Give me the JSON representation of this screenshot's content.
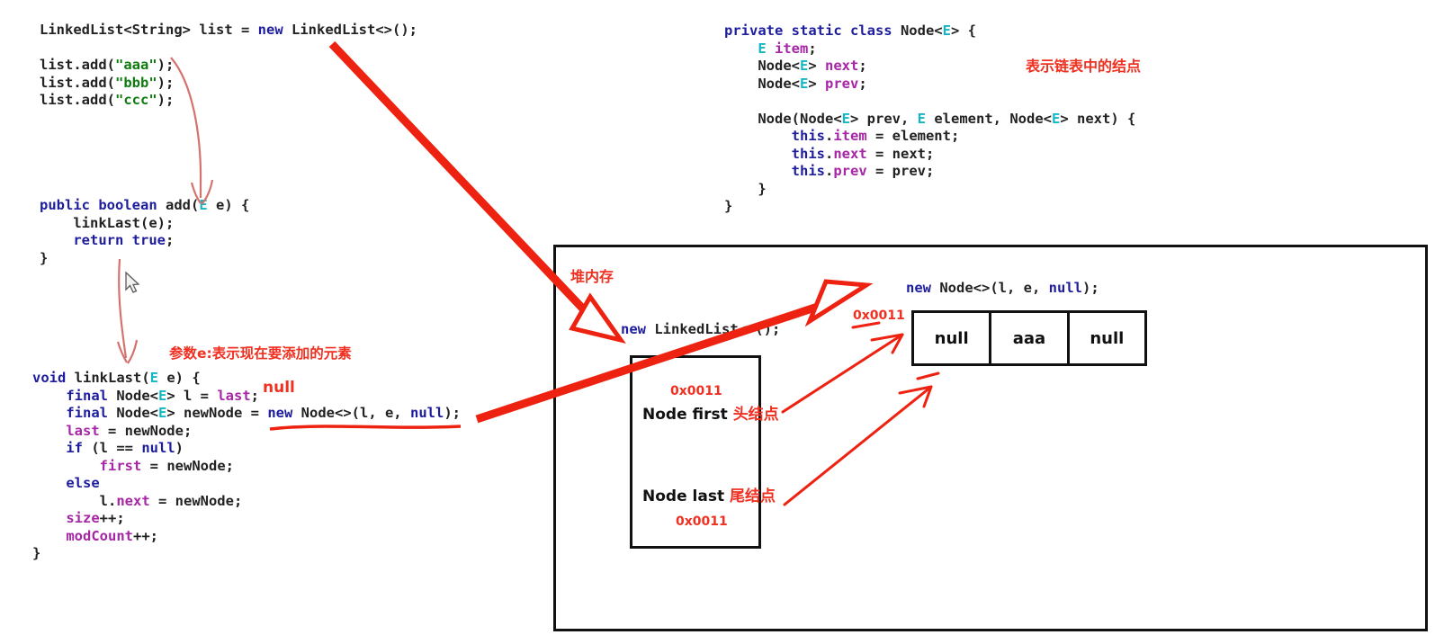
{
  "code_main": {
    "lines": [
      [
        {
          "t": "LinkedList",
          "c": "pl"
        },
        {
          "t": "<String> ",
          "c": "pl"
        },
        {
          "t": "list ",
          "c": "pl"
        },
        {
          "t": "= ",
          "c": "pl"
        },
        {
          "t": "new",
          "c": "kw"
        },
        {
          "t": " LinkedList<>();",
          "c": "pl"
        }
      ],
      [],
      [
        {
          "t": "list.add(",
          "c": "pl"
        },
        {
          "t": "\"aaa\"",
          "c": "str"
        },
        {
          "t": ");",
          "c": "pl"
        }
      ],
      [
        {
          "t": "list.add(",
          "c": "pl"
        },
        {
          "t": "\"bbb\"",
          "c": "str"
        },
        {
          "t": ");",
          "c": "pl"
        }
      ],
      [
        {
          "t": "list.add(",
          "c": "pl"
        },
        {
          "t": "\"ccc\"",
          "c": "str"
        },
        {
          "t": ");",
          "c": "pl"
        }
      ]
    ],
    "plain": "LinkedList<String> list = new LinkedList<>();\n\nlist.add(\"aaa\");\nlist.add(\"bbb\");\nlist.add(\"ccc\");"
  },
  "code_add": {
    "lines": [
      [
        {
          "t": "public boolean",
          "c": "kw"
        },
        {
          "t": " add(",
          "c": "pl"
        },
        {
          "t": "E",
          "c": "typ"
        },
        {
          "t": " e) {",
          "c": "pl"
        }
      ],
      [
        {
          "t": "    linkLast(e);",
          "c": "pl"
        }
      ],
      [
        {
          "t": "    ",
          "c": "pl"
        },
        {
          "t": "return true",
          "c": "kw"
        },
        {
          "t": ";",
          "c": "pl"
        }
      ],
      [
        {
          "t": "}",
          "c": "pl"
        }
      ]
    ],
    "plain": "public boolean add(E e) {\n    linkLast(e);\n    return true;\n}"
  },
  "code_linklast": {
    "lines": [
      [
        {
          "t": "void",
          "c": "kw"
        },
        {
          "t": " linkLast(",
          "c": "pl"
        },
        {
          "t": "E",
          "c": "typ"
        },
        {
          "t": " e) {",
          "c": "pl"
        }
      ],
      [
        {
          "t": "    ",
          "c": "pl"
        },
        {
          "t": "final",
          "c": "kw"
        },
        {
          "t": " Node<",
          "c": "pl"
        },
        {
          "t": "E",
          "c": "typ"
        },
        {
          "t": "> l = ",
          "c": "pl"
        },
        {
          "t": "last",
          "c": "fld"
        },
        {
          "t": ";",
          "c": "pl"
        }
      ],
      [
        {
          "t": "    ",
          "c": "pl"
        },
        {
          "t": "final",
          "c": "kw"
        },
        {
          "t": " Node<",
          "c": "pl"
        },
        {
          "t": "E",
          "c": "typ"
        },
        {
          "t": "> newNode = ",
          "c": "pl"
        },
        {
          "t": "new",
          "c": "kw"
        },
        {
          "t": " Node<>(l, e, ",
          "c": "pl"
        },
        {
          "t": "null",
          "c": "kw"
        },
        {
          "t": ");",
          "c": "pl"
        }
      ],
      [
        {
          "t": "    ",
          "c": "pl"
        },
        {
          "t": "last",
          "c": "fld"
        },
        {
          "t": " = newNode;",
          "c": "pl"
        }
      ],
      [
        {
          "t": "    ",
          "c": "pl"
        },
        {
          "t": "if",
          "c": "kw"
        },
        {
          "t": " (l == ",
          "c": "pl"
        },
        {
          "t": "null",
          "c": "kw"
        },
        {
          "t": ")",
          "c": "pl"
        }
      ],
      [
        {
          "t": "        ",
          "c": "pl"
        },
        {
          "t": "first",
          "c": "fld"
        },
        {
          "t": " = newNode;",
          "c": "pl"
        }
      ],
      [
        {
          "t": "    ",
          "c": "pl"
        },
        {
          "t": "else",
          "c": "kw"
        }
      ],
      [
        {
          "t": "        l.",
          "c": "pl"
        },
        {
          "t": "next",
          "c": "fld"
        },
        {
          "t": " = newNode;",
          "c": "pl"
        }
      ],
      [
        {
          "t": "    ",
          "c": "pl"
        },
        {
          "t": "size",
          "c": "fld"
        },
        {
          "t": "++;",
          "c": "pl"
        }
      ],
      [
        {
          "t": "    ",
          "c": "pl"
        },
        {
          "t": "modCount",
          "c": "fld"
        },
        {
          "t": "++;",
          "c": "pl"
        }
      ],
      [
        {
          "t": "}",
          "c": "pl"
        }
      ]
    ],
    "plain": "void linkLast(E e) {\n    final Node<E> l = last;\n    final Node<E> newNode = new Node<>(l, e, null);\n    last = newNode;\n    if (l == null)\n        first = newNode;\n    else\n        l.next = newNode;\n    size++;\n    modCount++;\n}"
  },
  "code_node": {
    "lines": [
      [
        {
          "t": "private static class",
          "c": "kw"
        },
        {
          "t": " Node<",
          "c": "pl"
        },
        {
          "t": "E",
          "c": "typ"
        },
        {
          "t": "> {",
          "c": "pl"
        }
      ],
      [
        {
          "t": "    ",
          "c": "pl"
        },
        {
          "t": "E",
          "c": "typ"
        },
        {
          "t": " ",
          "c": "pl"
        },
        {
          "t": "item",
          "c": "fld"
        },
        {
          "t": ";",
          "c": "pl"
        }
      ],
      [
        {
          "t": "    Node<",
          "c": "pl"
        },
        {
          "t": "E",
          "c": "typ"
        },
        {
          "t": "> ",
          "c": "pl"
        },
        {
          "t": "next",
          "c": "fld"
        },
        {
          "t": ";",
          "c": "pl"
        }
      ],
      [
        {
          "t": "    Node<",
          "c": "pl"
        },
        {
          "t": "E",
          "c": "typ"
        },
        {
          "t": "> ",
          "c": "pl"
        },
        {
          "t": "prev",
          "c": "fld"
        },
        {
          "t": ";",
          "c": "pl"
        }
      ],
      [],
      [
        {
          "t": "    Node(Node<",
          "c": "pl"
        },
        {
          "t": "E",
          "c": "typ"
        },
        {
          "t": "> prev, ",
          "c": "pl"
        },
        {
          "t": "E",
          "c": "typ"
        },
        {
          "t": " element, Node<",
          "c": "pl"
        },
        {
          "t": "E",
          "c": "typ"
        },
        {
          "t": "> next) {",
          "c": "pl"
        }
      ],
      [
        {
          "t": "        ",
          "c": "pl"
        },
        {
          "t": "this",
          "c": "kw"
        },
        {
          "t": ".",
          "c": "pl"
        },
        {
          "t": "item",
          "c": "fld"
        },
        {
          "t": " = element;",
          "c": "pl"
        }
      ],
      [
        {
          "t": "        ",
          "c": "pl"
        },
        {
          "t": "this",
          "c": "kw"
        },
        {
          "t": ".",
          "c": "pl"
        },
        {
          "t": "next",
          "c": "fld"
        },
        {
          "t": " = next;",
          "c": "pl"
        }
      ],
      [
        {
          "t": "        ",
          "c": "pl"
        },
        {
          "t": "this",
          "c": "kw"
        },
        {
          "t": ".",
          "c": "pl"
        },
        {
          "t": "prev",
          "c": "fld"
        },
        {
          "t": " = prev;",
          "c": "pl"
        }
      ],
      [
        {
          "t": "    }",
          "c": "pl"
        }
      ],
      [
        {
          "t": "}",
          "c": "pl"
        }
      ]
    ],
    "plain": "private static class Node<E> {\n    E item;\n    Node<E> next;\n    Node<E> prev;\n\n    Node(Node<E> prev, E element, Node<E> next) {\n        this.item = element;\n        this.next = next;\n        this.prev = prev;\n    }\n}"
  },
  "annotations": {
    "param_note": "参数e:表示现在要添加的元素",
    "node_class_note": "表示链表中的结点",
    "heap_label": "堆内存",
    "null_note": "null"
  },
  "heap": {
    "linkedlist_expr": "new LinkedList<>();",
    "node_expr": "new Node<>(l, e, null);",
    "ll_box": {
      "addr_top": "0x0011",
      "addr_bottom": "0x0011",
      "first_label": "Node first",
      "first_cn": "头结点",
      "last_label": "Node last",
      "last_cn": "尾结点"
    },
    "node_addr": "0x0011",
    "node_cells": [
      "null",
      "aaa",
      "null"
    ]
  },
  "colors": {
    "keyword": "#1d1d9e",
    "type": "#13b7c4",
    "field": "#a626a6",
    "string": "#107c10",
    "annotation_red": "#f03020",
    "arrow_red": "#ee2211",
    "box_black": "#111111"
  }
}
